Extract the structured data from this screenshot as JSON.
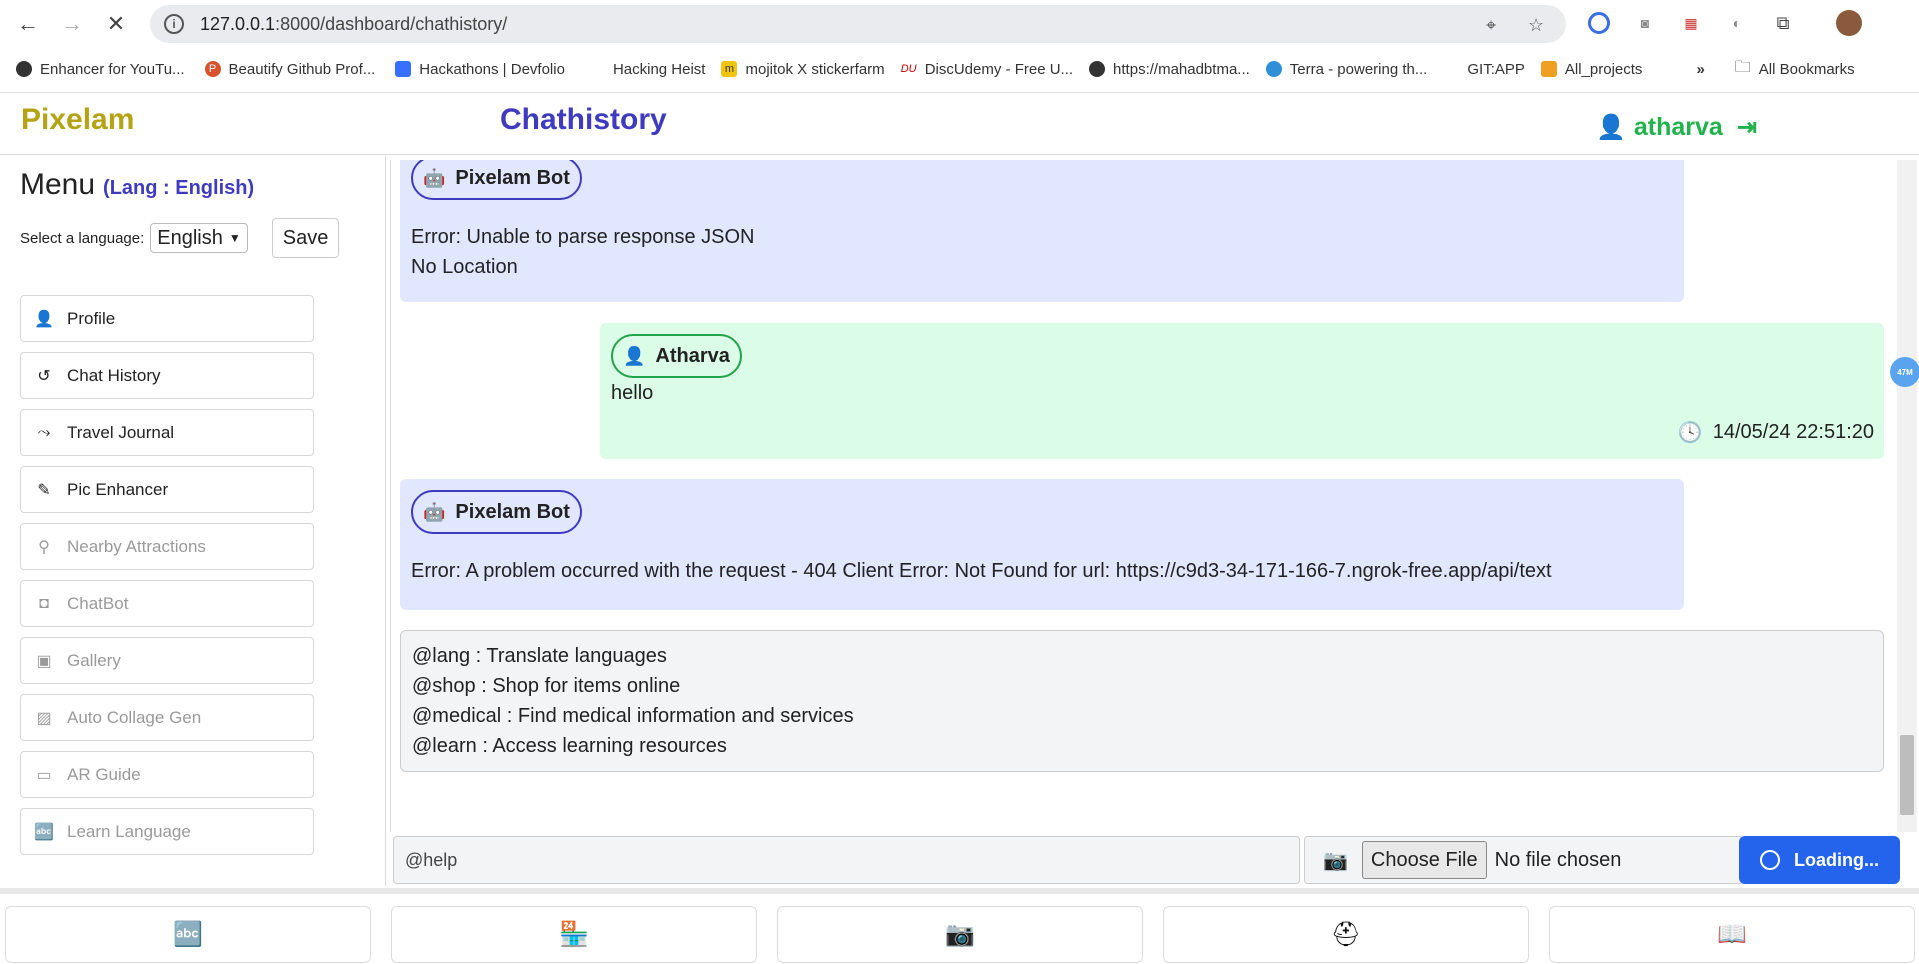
{
  "browser": {
    "url_host": "127.0.0.1",
    "url_rest": ":8000/dashboard/chathistory/",
    "bookmarks": [
      "Enhancer for YouTu...",
      "Beautify Github Prof...",
      "Hackathons | Devfolio",
      "Hacking Heist",
      "mojitok X stickerfarm",
      "DiscUdemy - Free U...",
      "https://mahadbtma...",
      "Terra - powering th...",
      "GIT:APP",
      "All_projects"
    ],
    "more": "»",
    "all_bookmarks": "All Bookmarks"
  },
  "header": {
    "brand": "Pixelam",
    "title": "Chathistory",
    "username": "atharva"
  },
  "sidebar": {
    "menu_title": "Menu",
    "lang_label": "(Lang : English)",
    "select_label": "Select a language:",
    "select_value": "English",
    "save_label": "Save",
    "items": [
      {
        "label": "Profile",
        "icon": "user-icon"
      },
      {
        "label": "Chat History",
        "icon": "history-icon"
      },
      {
        "label": "Travel Journal",
        "icon": "route-icon"
      },
      {
        "label": "Pic Enhancer",
        "icon": "magic-wand-icon"
      },
      {
        "label": "Nearby Attractions",
        "icon": "map-location-icon"
      },
      {
        "label": "ChatBot",
        "icon": "robot-icon"
      },
      {
        "label": "Gallery",
        "icon": "images-icon"
      },
      {
        "label": "Auto Collage Gen",
        "icon": "image-icon"
      },
      {
        "label": "AR Guide",
        "icon": "vr-cardboard-icon"
      },
      {
        "label": "Learn Language",
        "icon": "language-icon"
      }
    ]
  },
  "chat": {
    "messages": [
      {
        "sender": "Pixelam Bot",
        "lines": [
          "Error: Unable to parse response JSON",
          "No Location"
        ]
      },
      {
        "sender": "Atharva",
        "lines": [
          "hello"
        ],
        "time": "14/05/24 22:51:20"
      },
      {
        "sender": "Pixelam Bot",
        "lines": [
          "Error: A problem occurred with the request - 404 Client Error: Not Found for url: https://c9d3-34-171-166-7.ngrok-free.app/api/text"
        ]
      }
    ],
    "help_lines": [
      "@lang : Translate languages",
      "@shop : Shop for items online",
      "@medical : Find medical information and services",
      "@learn : Access learning resources"
    ],
    "badge": "47M"
  },
  "composer": {
    "input_value": "@help",
    "file_button": "Choose File",
    "file_status": "No file chosen",
    "submit_label": "Loading..."
  },
  "bottom_nav": [
    {
      "icon": "language-icon"
    },
    {
      "icon": "store-icon"
    },
    {
      "icon": "camera-icon"
    },
    {
      "icon": "medical-kit-icon"
    },
    {
      "icon": "book-icon"
    }
  ]
}
